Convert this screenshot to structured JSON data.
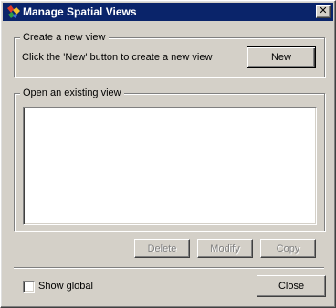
{
  "window": {
    "title": "Manage Spatial Views",
    "close_glyph": "✕"
  },
  "create_group": {
    "legend": "Create a new view",
    "instruction": "Click the 'New' button to create a new view",
    "new_button": "New"
  },
  "open_group": {
    "legend": "Open an existing view",
    "views": []
  },
  "actions": {
    "delete": "Delete",
    "modify": "Modify",
    "copy": "Copy"
  },
  "footer": {
    "show_global_label": "Show global",
    "show_global_checked": false,
    "close_button": "Close"
  },
  "icons": {
    "app": "arcgis-app-icon",
    "close": "close-icon",
    "checkbox": "checkbox-icon"
  }
}
